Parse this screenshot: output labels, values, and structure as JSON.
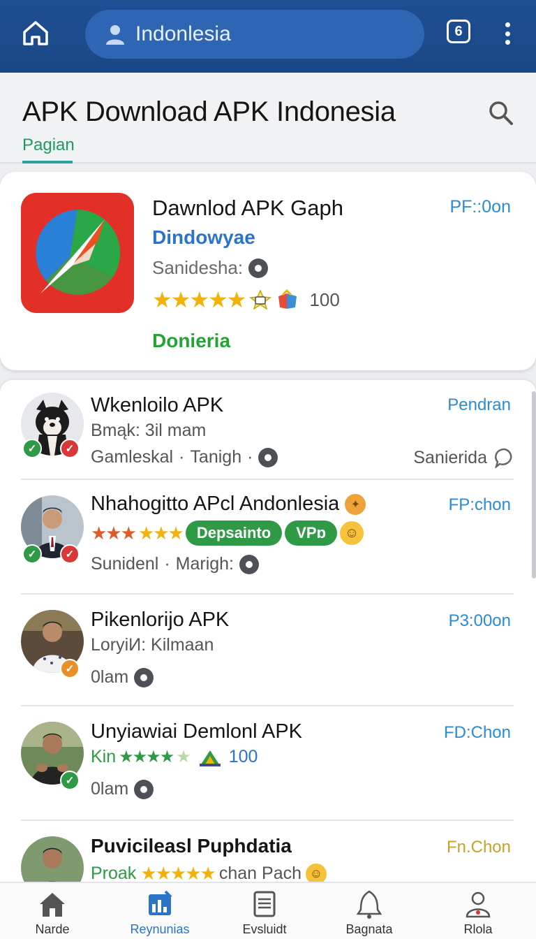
{
  "topbar": {
    "search_value": "Indonlesia",
    "badge_text": "6"
  },
  "header": {
    "title": "APK Download APK Indonesia",
    "tab": "Pagian"
  },
  "featured": {
    "title": "Dawnlod APK Gaph",
    "subtitle": "Dindowyae",
    "category": "Sanidesha:",
    "rating_count": "100",
    "action": "Donieria",
    "price": "PF::0on"
  },
  "list": [
    {
      "title": "Wkenloilo APK",
      "sub": "Bmąk: 3il mam",
      "meta1": "Gamleskal",
      "meta2": "Tanigh",
      "right_meta": "Sanierida",
      "price": "Pendran"
    },
    {
      "title": "Nhahogitto APcl Andonlesia",
      "pill1": "Depsainto",
      "pill2": "VPɒ",
      "meta1": "Sunidenl",
      "meta2": "Marigh:",
      "price": "FP:chon"
    },
    {
      "title": "Pikenlorijo APK",
      "sub": "LoryiИ: Kilmaan",
      "meta1": "0lam",
      "price": "P3:00on"
    },
    {
      "title": "Unyiawiai Demlonl APK",
      "prefix": "Kin",
      "rating_count": "100",
      "meta1": "0lam",
      "price": "FD:Chon"
    },
    {
      "title": "Puvicileasl Puphdatia",
      "prefix": "Proak",
      "tail": "chan Pach",
      "price": "Fn.Chon"
    }
  ],
  "bottom_nav": [
    {
      "label": "Narde"
    },
    {
      "label": "Reynunias"
    },
    {
      "label": "Evsluidt"
    },
    {
      "label": "Bagnata"
    },
    {
      "label": "Rlola"
    }
  ],
  "colors": {
    "topbar": "#1e4f93",
    "accent_blue": "#2b74c7",
    "accent_green": "#24a336",
    "price": "#2b8bd3"
  }
}
